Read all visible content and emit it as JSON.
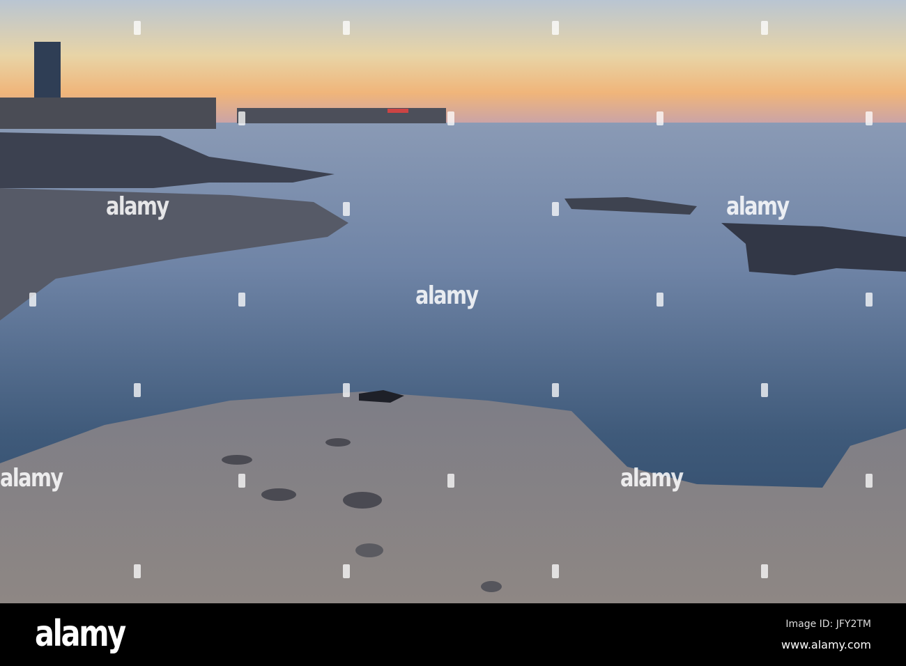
{
  "watermark": {
    "text": "alamy"
  },
  "footer": {
    "logo": "alamy",
    "image_id": "Image ID: JFY2TM",
    "website": "www.alamy.com"
  }
}
